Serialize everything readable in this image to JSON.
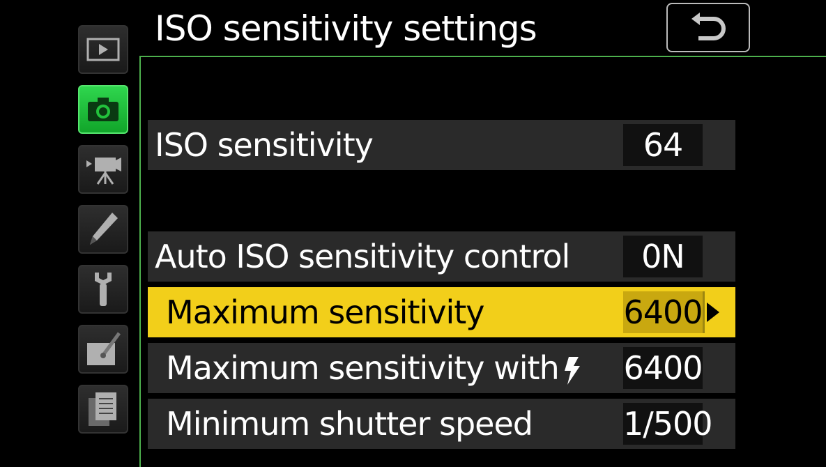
{
  "header": {
    "title": "ISO sensitivity settings",
    "back_icon": "return-arrow-icon"
  },
  "sidebar": {
    "items": [
      {
        "name": "playback",
        "icon": "playback-icon",
        "active": false
      },
      {
        "name": "photo-shooting",
        "icon": "camera-icon",
        "active": true
      },
      {
        "name": "movie-shooting",
        "icon": "movie-camera-icon",
        "active": false
      },
      {
        "name": "custom-settings",
        "icon": "pencil-icon",
        "active": false
      },
      {
        "name": "setup",
        "icon": "wrench-icon",
        "active": false
      },
      {
        "name": "retouch",
        "icon": "retouch-brush-icon",
        "active": false
      },
      {
        "name": "my-menu",
        "icon": "menu-list-icon",
        "active": false
      }
    ],
    "active_color": "#22c23c"
  },
  "menu": {
    "rows": [
      {
        "label": "ISO sensitivity",
        "value": "64"
      },
      {
        "label": "Auto ISO sensitivity control",
        "value": "0N"
      },
      {
        "label": "Maximum sensitivity",
        "value": "6400",
        "selected": true
      },
      {
        "label": "Maximum sensitivity with",
        "value": "6400",
        "icon": "flash-icon"
      },
      {
        "label": "Minimum shutter speed",
        "value": "1/500"
      }
    ],
    "highlight_color": "#f2cf1a"
  }
}
